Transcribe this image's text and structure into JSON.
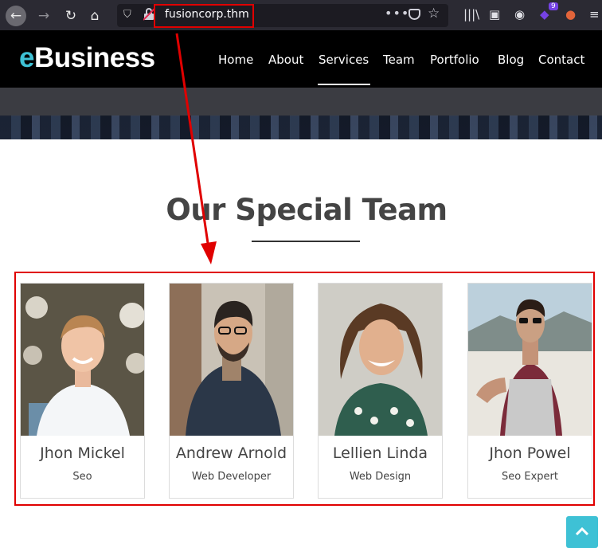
{
  "browser": {
    "url": "fusioncorp.thm",
    "extension_badge": "9"
  },
  "site": {
    "logo_accent": "e",
    "logo_rest": "Business",
    "menu": [
      "Home",
      "About",
      "Services",
      "Team",
      "Portfolio",
      "Blog",
      "Contact"
    ],
    "active_menu": "Services"
  },
  "team": {
    "title": "Our Special Team",
    "members": [
      {
        "name": "Jhon Mickel",
        "role": "Seo"
      },
      {
        "name": "Andrew Arnold",
        "role": "Web Developer"
      },
      {
        "name": "Lellien Linda",
        "role": "Web Design"
      },
      {
        "name": "Jhon Powel",
        "role": "Seo Expert"
      }
    ]
  },
  "colors": {
    "accent": "#3ec1d5",
    "annotation": "#e00000",
    "header_bg": "#000000"
  }
}
